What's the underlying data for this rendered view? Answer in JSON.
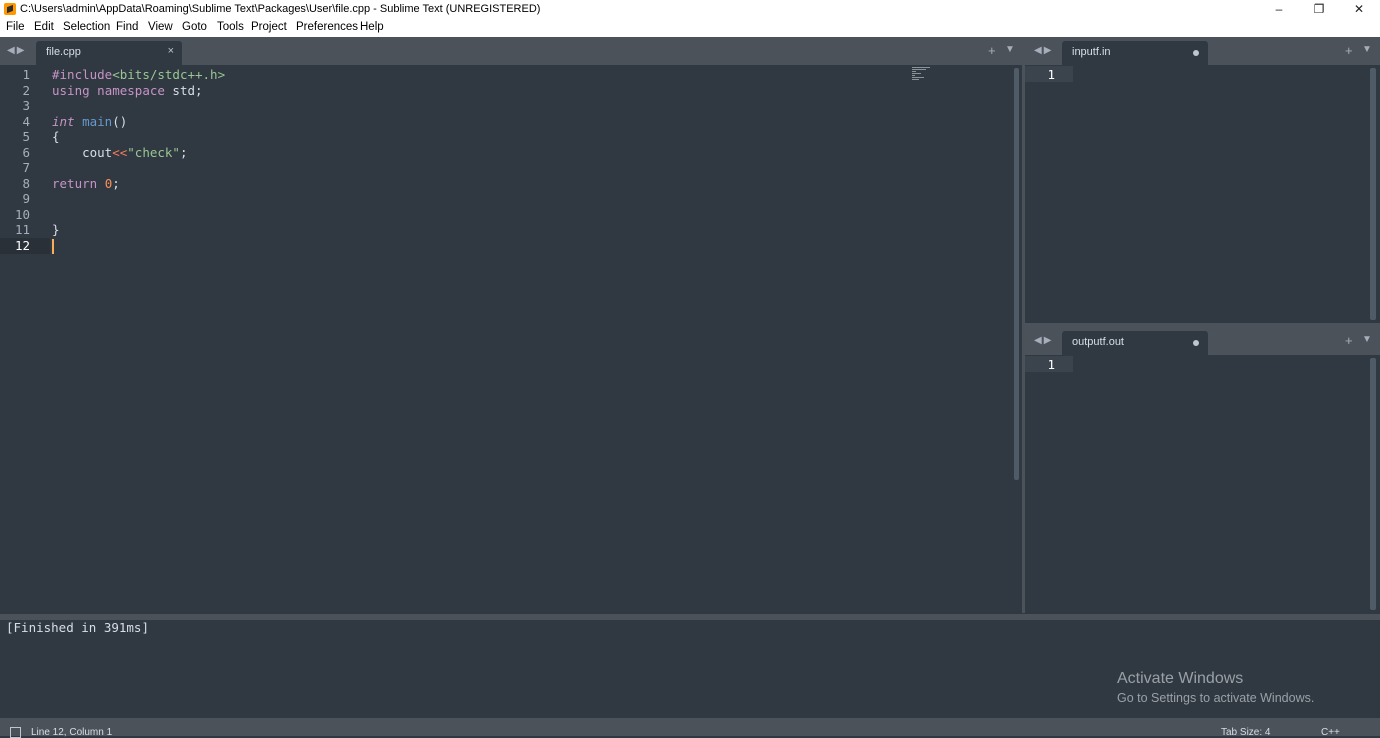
{
  "window": {
    "title": "C:\\Users\\admin\\AppData\\Roaming\\Sublime Text\\Packages\\User\\file.cpp - Sublime Text (UNREGISTERED)",
    "minimize": "–",
    "maximize": "❐",
    "close": "✕"
  },
  "menu": [
    "File",
    "Edit",
    "Selection",
    "Find",
    "View",
    "Goto",
    "Tools",
    "Project",
    "Preferences",
    "Help"
  ],
  "left_pane": {
    "tab": {
      "label": "file.cpp",
      "close": "×"
    },
    "line_numbers": [
      "1",
      "2",
      "3",
      "4",
      "5",
      "6",
      "7",
      "8",
      "9",
      "10",
      "11",
      "12"
    ],
    "current_line": "12"
  },
  "code": {
    "l1_a": "#include",
    "l1_b": "<bits/stdc++.h>",
    "l2_a": "using",
    "l2_b": "namespace",
    "l2_c": " std;",
    "l4_a": "int",
    "l4_b": "main",
    "l4_c": "()",
    "l5": "{",
    "l6_a": "    cout",
    "l6_b": "<<",
    "l6_c": "\"check\"",
    "l6_d": ";",
    "l8_a": "return ",
    "l8_b": "0",
    "l8_c": ";",
    "l11": "}"
  },
  "right_top": {
    "tab": "inputf.in",
    "line_number": "1"
  },
  "right_bottom": {
    "tab": "outputf.out",
    "line_number": "1"
  },
  "controls": {
    "nav": "◀▶",
    "plus": "+",
    "dropdown": "▼"
  },
  "build_output": "[Finished in 391ms]",
  "watermark": {
    "title": "Activate Windows",
    "subtitle": "Go to Settings to activate Windows."
  },
  "status": {
    "position": "Line 12, Column 1",
    "tab_size": "Tab Size: 4",
    "syntax": "C++"
  }
}
